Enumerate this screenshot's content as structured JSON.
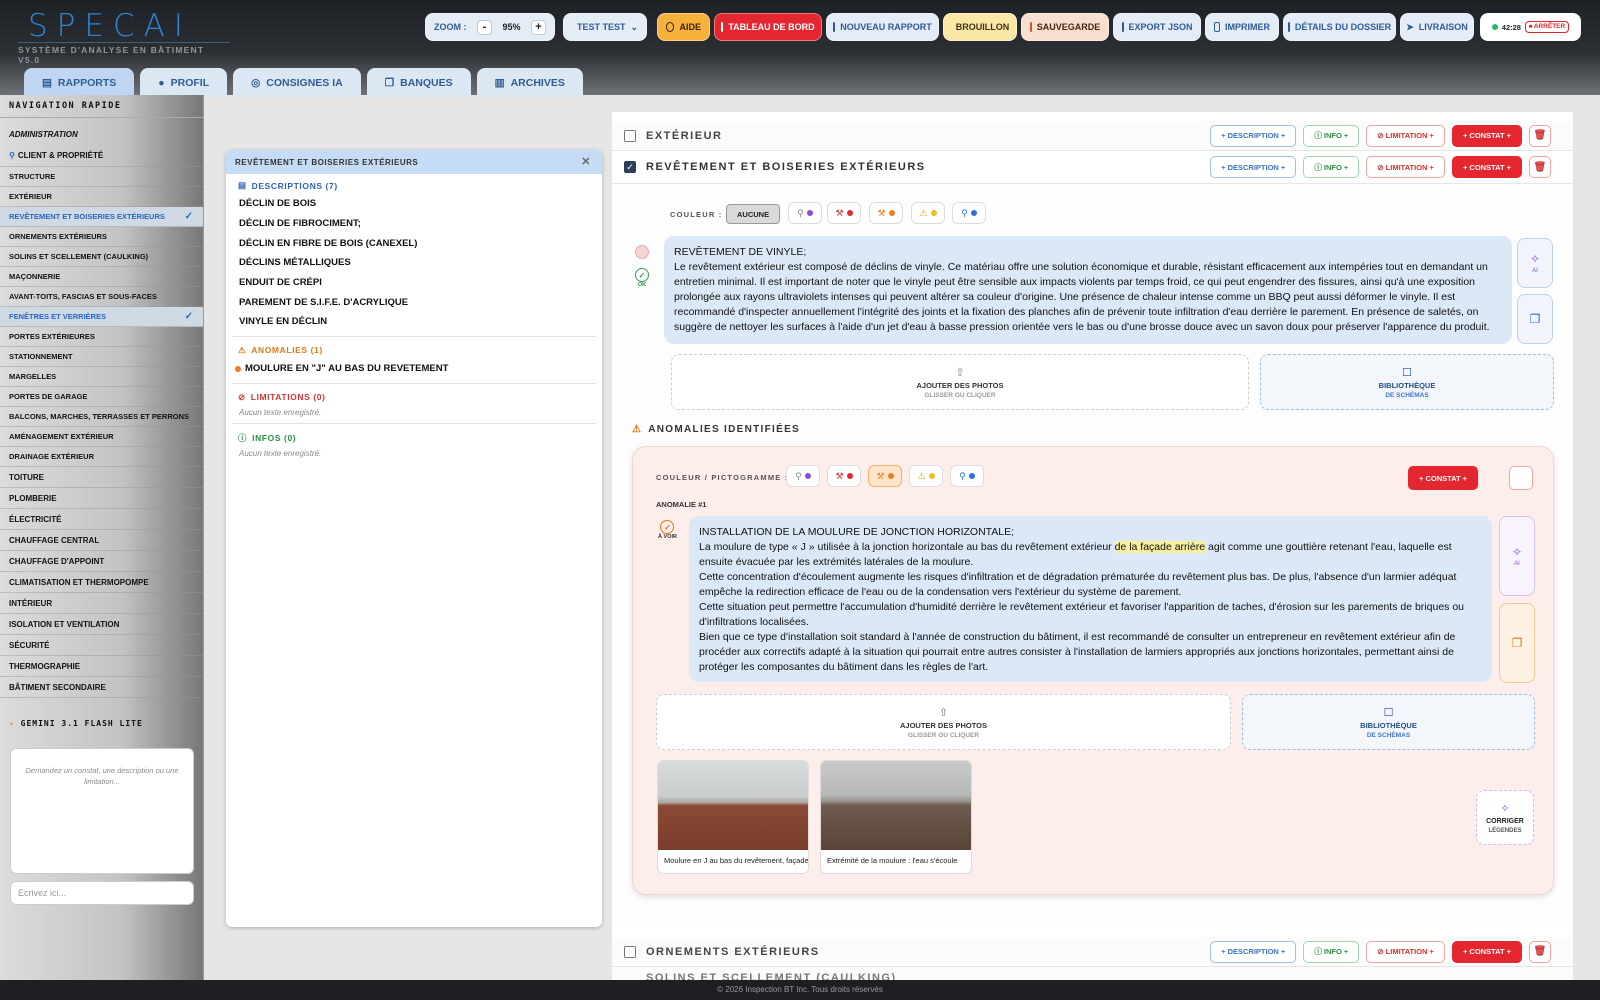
{
  "app": {
    "logo": "SPECAI",
    "subtitle": "SYSTÈME D'ANALYSE EN BÂTIMENT V5.0"
  },
  "toolbar": {
    "zoom_label": "ZOOM :",
    "zoom_minus": "-",
    "zoom_value": "95%",
    "zoom_plus": "+",
    "user": "TEST TEST",
    "aide": "AIDE",
    "tableau": "TABLEAU DE BORD",
    "nouveau": "NOUVEAU RAPPORT",
    "brouillon": "BROUILLON",
    "sauvegarde": "SAUVEGARDE",
    "export": "EXPORT JSON",
    "imprimer": "IMPRIMER",
    "details": "DÉTAILS DU DOSSIER",
    "livraison": "LIVRAISON",
    "timer": "42:28",
    "arreter": "ARRÊTER"
  },
  "tabs": [
    "RAPPORTS",
    "PROFIL",
    "CONSIGNES IA",
    "BANQUES",
    "ARCHIVES"
  ],
  "sidebar": {
    "heading": "NAVIGATION RAPIDE",
    "admin": "ADMINISTRATION",
    "client": "CLIENT & PROPRIÉTÉ",
    "items": [
      "STRUCTURE",
      "EXTÉRIEUR",
      "REVÊTEMENT ET BOISERIES EXTÉRIEURS",
      "ORNEMENTS EXTÉRIEURS",
      "SOLINS ET SCELLEMENT (CAULKING)",
      "MAÇONNERIE",
      "AVANT-TOITS, FASCIAS ET SOUS-FACES",
      "FENÊTRES ET VERRIÈRES",
      "PORTES EXTÉRIEURES",
      "STATIONNEMENT",
      "MARGELLES",
      "PORTES DE GARAGE",
      "BALCONS, MARCHES, TERRASSES ET PERRONS",
      "AMÉNAGEMENT EXTÉRIEUR",
      "DRAINAGE EXTÉRIEUR"
    ],
    "big_items": [
      "TOITURE",
      "PLOMBERIE",
      "ÉLECTRICITÉ",
      "CHAUFFAGE CENTRAL",
      "CHAUFFAGE D'APPOINT",
      "CLIMATISATION ET THERMOPOMPE",
      "INTÉRIEUR",
      "ISOLATION ET VENTILATION",
      "SÉCURITÉ",
      "THERMOGRAPHIE",
      "BÂTIMENT SECONDAIRE"
    ],
    "gemini": "GEMINI 3.1 FLASH LITE",
    "prompt": "Demandez un constat, une description ou une limitation...",
    "write": "Ecrivez ici..."
  },
  "panel": {
    "title": "REVÊTEMENT ET BOISERIES EXTÉRIEURS",
    "desc_title": "DESCRIPTIONS (7)",
    "descriptions": [
      "DÉCLIN DE BOIS",
      "DÉCLIN DE FIBROCIMENT;",
      "DÉCLIN EN FIBRE DE BOIS (CANEXEL)",
      "DÉCLINS MÉTALLIQUES",
      "ENDUIT DE CRÉPI",
      "PAREMENT DE S.I.F.E. D'ACRYLIQUE",
      "VINYLE EN DÉCLIN"
    ],
    "anom_title": "ANOMALIES (1)",
    "anomalies": [
      "MOULURE EN \"J\" AU BAS DU REVETEMENT"
    ],
    "lim_title": "LIMITATIONS (0)",
    "lim_empty": "Aucun texte enregistré.",
    "info_title": "INFOS (0)",
    "info_empty": "Aucun texte enregistré."
  },
  "sections": {
    "exterieur": "EXTÉRIEUR",
    "revetement": "REVÊTEMENT ET BOISERIES EXTÉRIEURS",
    "ornements": "ORNEMENTS EXTÉRIEURS",
    "btn_desc": "+ DESCRIPTION +",
    "btn_info": "INFO +",
    "btn_lim": "LIMITATION +",
    "btn_const": "+ CONSTAT +"
  },
  "editor": {
    "couleur": "COULEUR :",
    "aucune": "AUCUNE",
    "status": "OK",
    "text_title": "REVÊTEMENT DE VINYLE;",
    "text_body": "Le revêtement extérieur est composé de déclins de vinyle. Ce matériau offre une solution économique et durable, résistant efficacement aux intempéries tout en demandant un entretien minimal. Il est important de noter que le vinyle peut être sensible aux impacts violents par temps froid, ce qui peut engendrer des fissures, ainsi qu'à une exposition prolongée aux rayons ultraviolets intenses qui peuvent altérer sa couleur d'origine. Une présence de chaleur intense comme un BBQ peut aussi déformer le vinyle. Il est recommandé d'inspecter annuellement l'intégrité des joints et la fixation des planches afin de prévenir toute infiltration d'eau derrière le parement. En présence de saletés, on suggère de nettoyer les surfaces à l'aide d'un jet d'eau à basse pression orientée vers le bas ou d'une brosse douce avec un savon doux pour préserver l'apparence du produit.",
    "ai": "AI",
    "photos": "AJOUTER DES PHOTOS",
    "photos_sub": "GLISSER OU CLIQUER",
    "lib": "BIBLIOTHÈQUE",
    "lib_sub": "DE SCHÉMAS"
  },
  "anomalies": {
    "title": "ANOMALIES IDENTIFIÉES",
    "couleur": "COULEUR / PICTOGRAMME :",
    "const": "+ CONSTAT +",
    "num": "ANOMALIE #1",
    "status": "À VOIR",
    "t_title": "INSTALLATION DE LA MOULURE DE JONCTION HORIZONTALE;",
    "t_p1a": "La moulure de type « J » utilisée à la jonction horizontale au bas du revêtement extérieur ",
    "t_hl": "de la façade arrière",
    "t_p1b": " agit comme une gouttière retenant l'eau, laquelle est ensuite évacuée par les extrémités latérales de la moulure.",
    "t_p2": "Cette concentration d'écoulement augmente les risques d'infiltration et de dégradation prématurée du revêtement plus bas. De plus, l'absence d'un larmier adéquat empêche la redirection efficace de l'eau ou de la condensation vers l'extérieur du système de parement.",
    "t_p3": "Cette situation peut permettre l'accumulation d'humidité derrière le revêtement extérieur et favoriser l'apparition de taches, d'érosion sur les parements de briques ou d'infiltrations localisées.",
    "t_p4": "Bien que ce type d'installation soit standard à l'année de construction du bâtiment, il est recommandé de consulter un entrepreneur en revêtement extérieur afin de procéder aux correctifs adapté à la situation qui pourrait entre autres consister à l'installation de larmiers appropriés aux jonctions horizontales, permettant ainsi de protéger les composantes du bâtiment dans les règles de l'art.",
    "cap1": "Moulure en J au bas du revêtement, façade arrière",
    "cap2": "Extrémité de la moulure : l'eau s'écoule",
    "corriger": "CORRIGER",
    "legendes": "LÉGENDES"
  },
  "next": {
    "soulins": "SOLINS ET SCELLEMENT (CAULKING)"
  },
  "footer": "© 2026 Inspection BT Inc. Tous droits réservés",
  "colors": {
    "accent": "#2c86d6",
    "red": "#e4262f",
    "purple": "#8a4fd6",
    "orange": "#ef7d1a",
    "yellow": "#e7c21a",
    "blue": "#2f6fdc"
  }
}
